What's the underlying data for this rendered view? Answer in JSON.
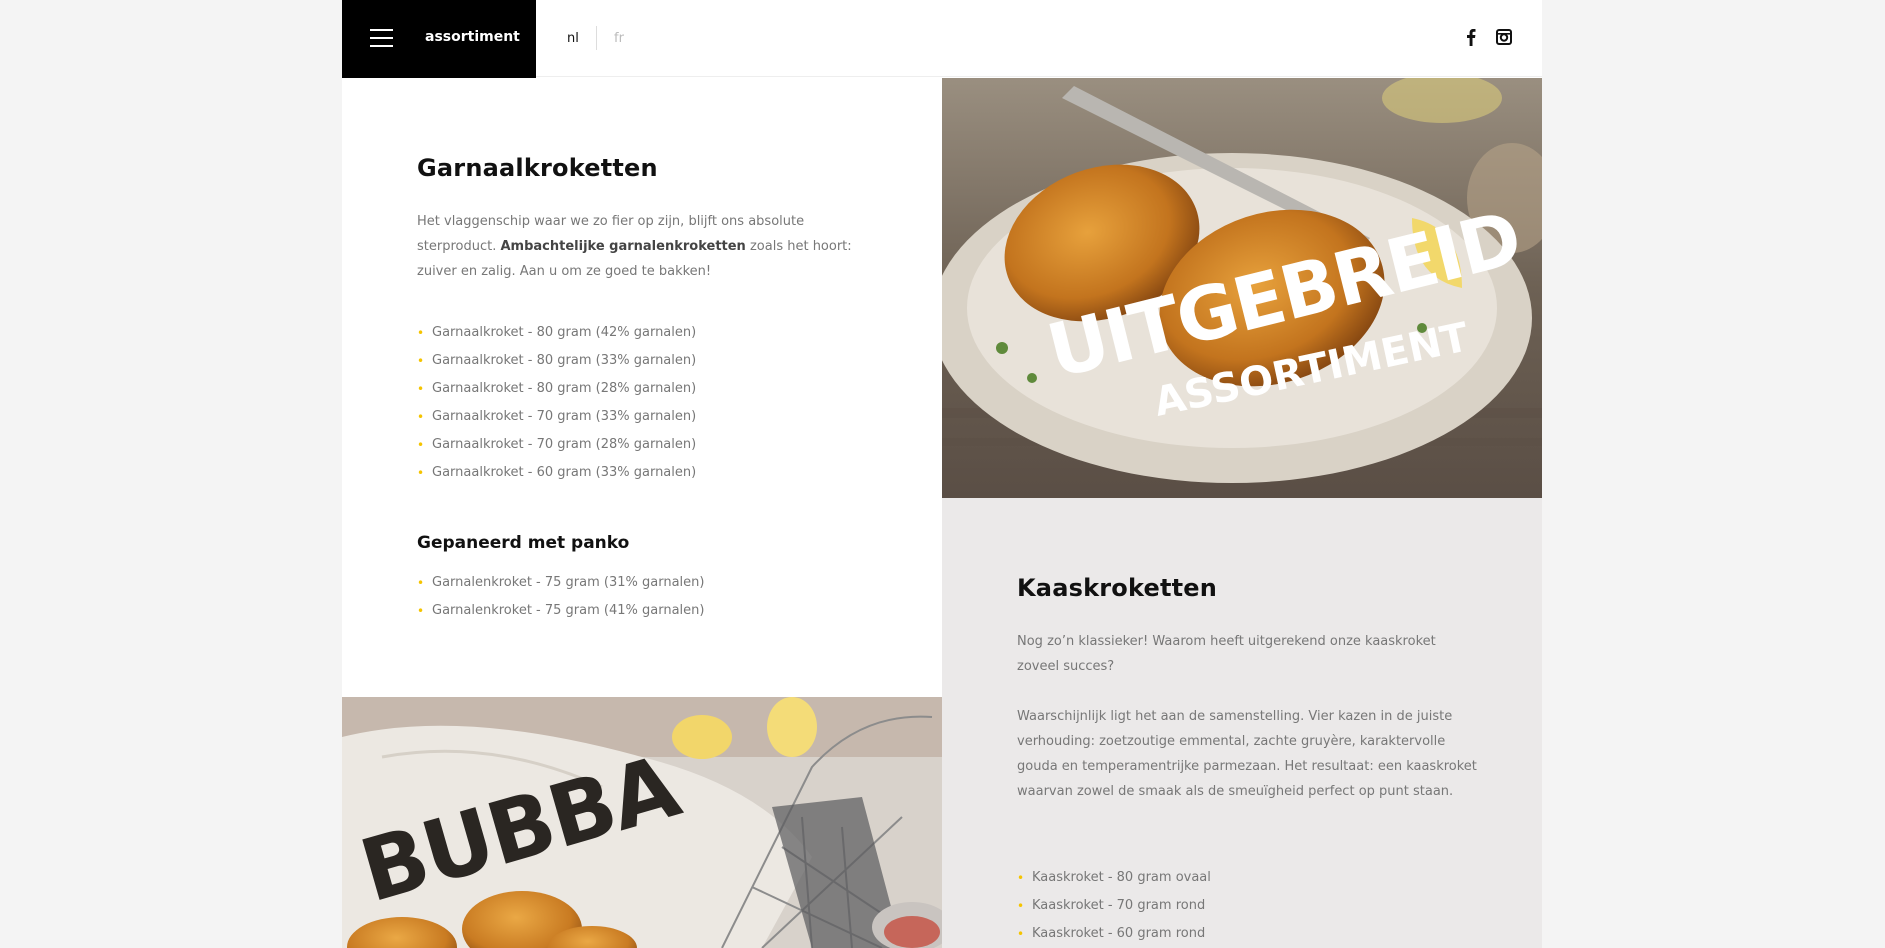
{
  "header": {
    "menu_title": "assortiment",
    "lang_nl": "nl",
    "lang_fr": "fr"
  },
  "garnaal": {
    "title": "Garnaalkroketten",
    "intro_part1": "Het vlaggenschip waar we zo fier op zijn, blijft ons absolute sterproduct. ",
    "intro_bold": "Ambachtelijke garnalenkroketten",
    "intro_part2": " zoals het hoort: zuiver en zalig. Aan u om ze goed te bakken!",
    "items": [
      "Garnaalkroket - 80 gram (42% garnalen)",
      "Garnaalkroket - 80 gram (33% garnalen)",
      "Garnaalkroket - 80 gram (28% garnalen)",
      "Garnaalkroket - 70 gram (33% garnalen)",
      "Garnaalkroket - 70 gram (28% garnalen)",
      "Garnaalkroket - 60 gram (33% garnalen)"
    ],
    "panko_title": "Gepaneerd met panko",
    "panko_items": [
      "Garnalenkroket - 75 gram (31% garnalen)",
      "Garnalenkroket - 75 gram (41% garnalen)"
    ]
  },
  "hero": {
    "line1": "UITGEBREID",
    "line2": "ASSORTIMENT"
  },
  "kaas": {
    "title": "Kaaskroketten",
    "para1": "Nog zo’n klassieker! Waarom heeft uitgerekend onze kaaskroket zoveel succes?",
    "para2": "Waarschijnlijk ligt het aan de samenstelling. Vier kazen in de juiste verhouding: zoetzoutige emmental, zachte gruyère, karaktervolle gouda en temperamentrijke parmezaan. Het resultaat: een kaaskroket waarvan zowel de smaak als de smeuïgheid perfect op punt staan.",
    "items": [
      "Kaaskroket - 80 gram ovaal",
      "Kaaskroket - 70 gram rond",
      "Kaaskroket - 60 gram rond"
    ]
  },
  "bottom_image": {
    "brand": "BUBBA"
  },
  "colors": {
    "bullet": "#f5c400",
    "menu_bg": "#000000",
    "grey_panel": "#ebe9e9"
  }
}
